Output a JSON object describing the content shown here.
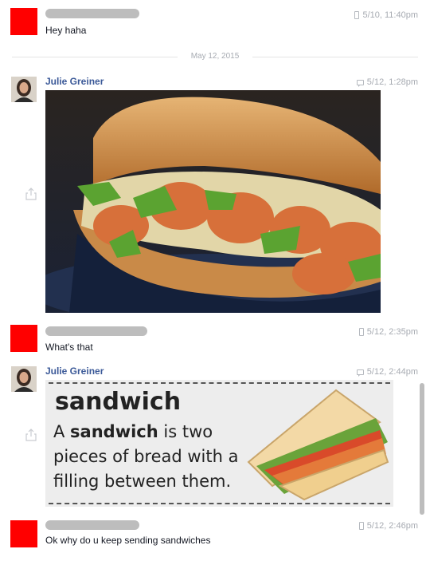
{
  "messages": [
    {
      "time": "5/10, 11:40pm",
      "text": "Hey haha"
    },
    {
      "name": "Julie Greiner",
      "time": "5/12, 1:28pm"
    },
    {
      "time": "5/12, 2:35pm",
      "text": "What's that"
    },
    {
      "name": "Julie Greiner",
      "time": "5/12, 2:44pm"
    },
    {
      "time": "5/12, 2:46pm",
      "text": "Ok why do u keep sending sandwiches"
    }
  ],
  "date_divider": "May 12, 2015",
  "card": {
    "headword": "sandwich",
    "definition_prefix": "A ",
    "definition_bold": "sandwich",
    "definition_rest": " is two pieces of bread with a filling between them."
  },
  "colors": {
    "self_avatar": "#ff0000",
    "name_link": "#3b5998",
    "timestamp": "#a7abb2"
  }
}
